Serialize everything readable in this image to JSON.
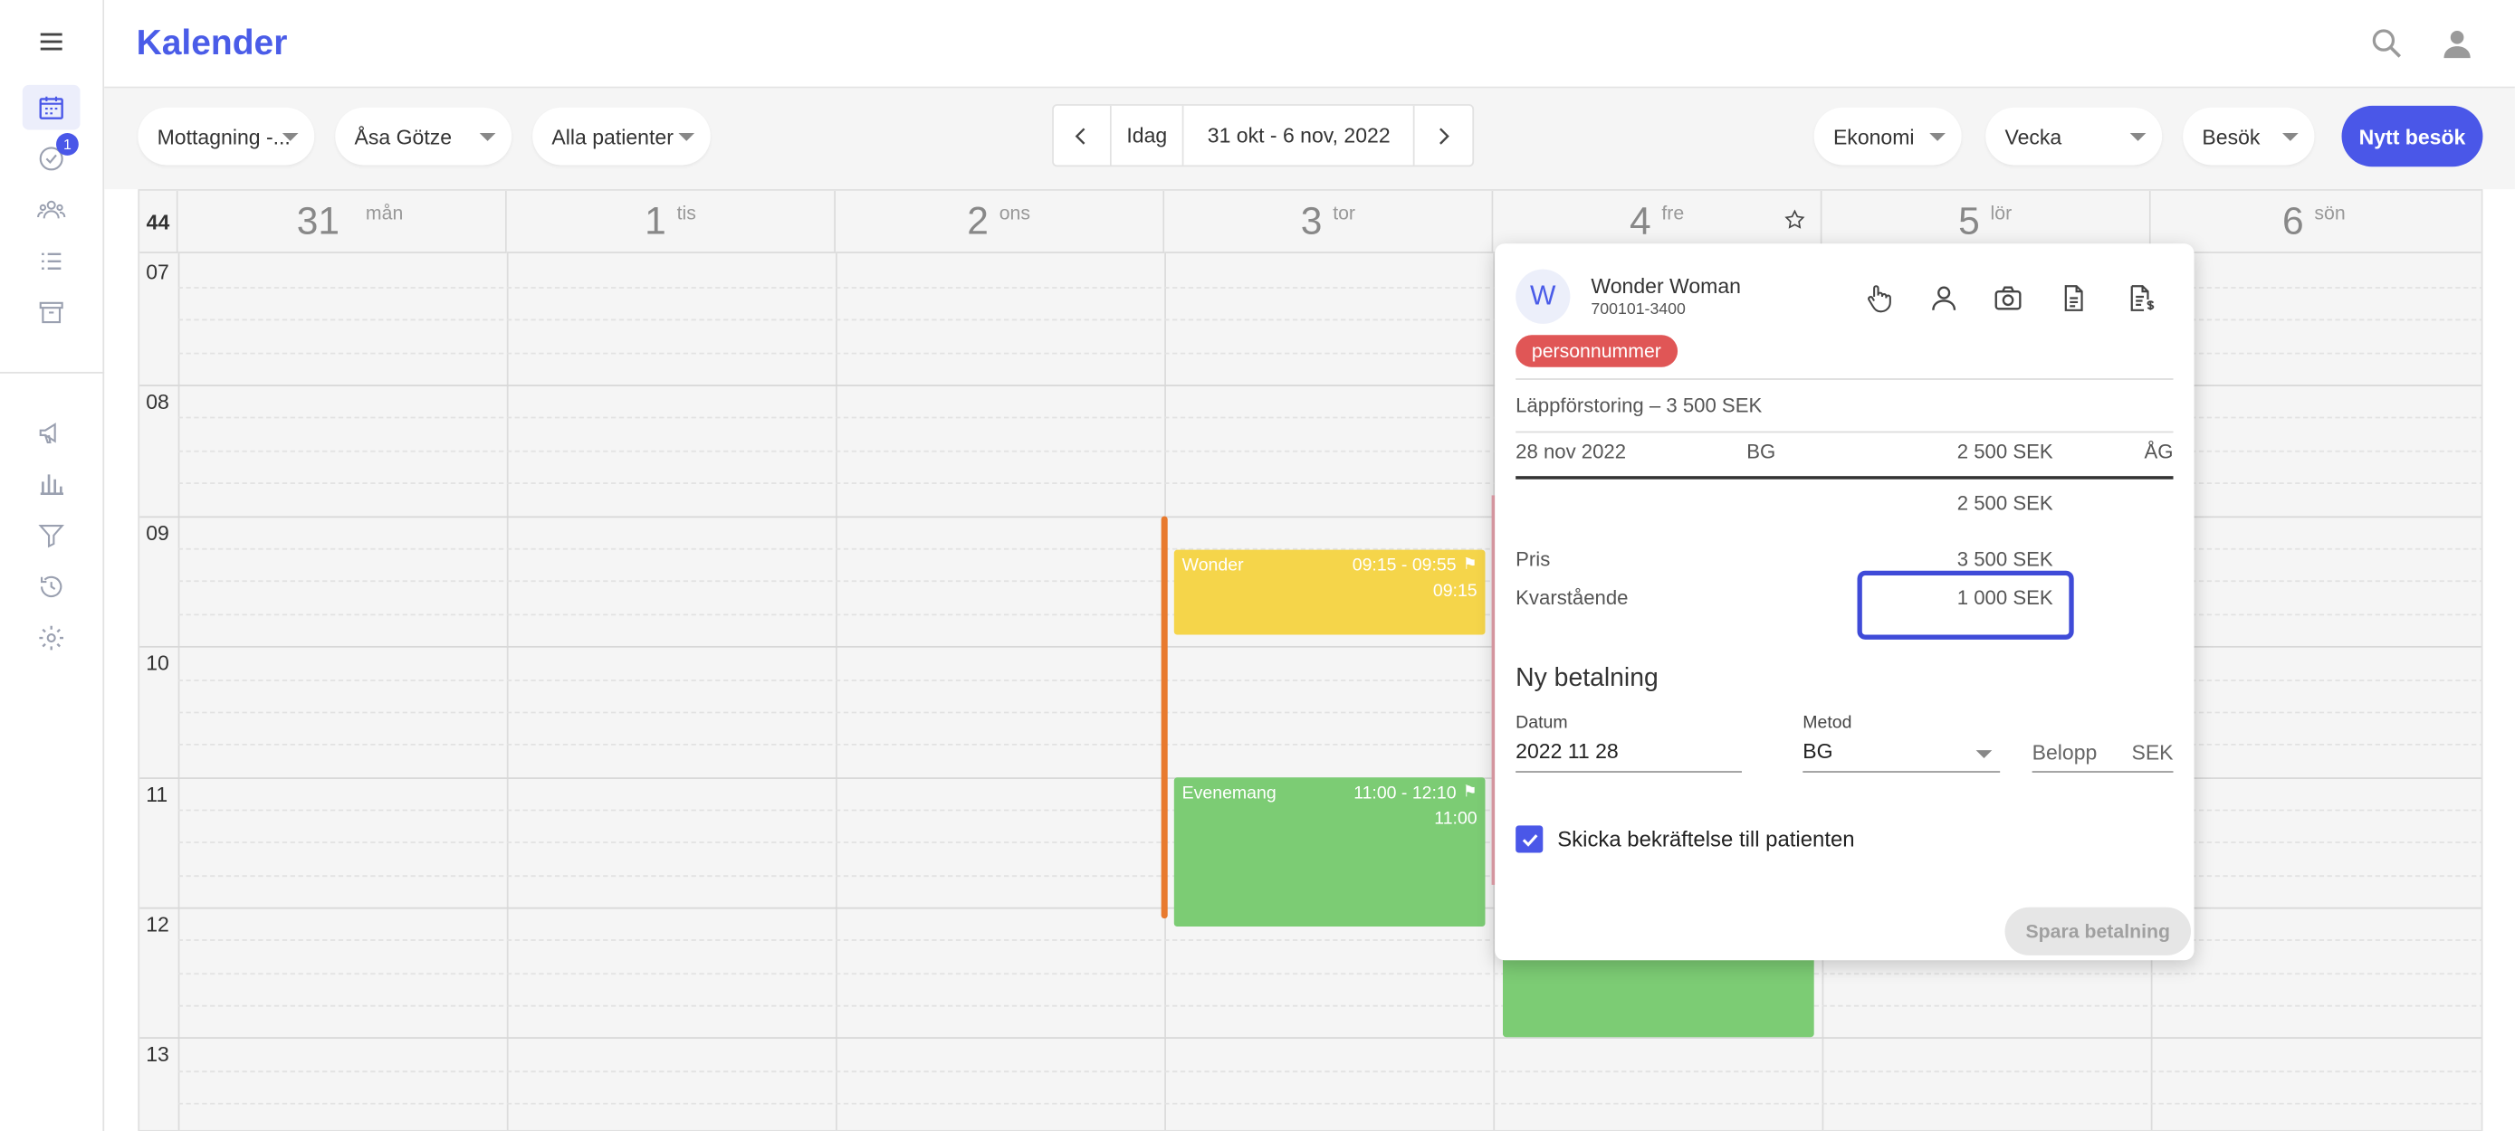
{
  "header": {
    "title": "Kalender"
  },
  "sidebar": {
    "badge_count": "1",
    "icons": [
      "calendar-icon",
      "tasks-icon",
      "people-icon",
      "list-icon",
      "archive-icon",
      "megaphone-icon",
      "bar-chart-icon",
      "filter-icon",
      "history-icon",
      "settings-icon"
    ]
  },
  "toolbar": {
    "reception": "Mottagning -...",
    "practitioner": "Åsa Götze",
    "patients": "Alla patienter",
    "today": "Idag",
    "date_range": "31 okt - 6 nov, 2022",
    "economy": "Ekonomi",
    "view": "Vecka",
    "visit_type": "Besök",
    "new_visit": "Nytt besök"
  },
  "calendar": {
    "week": "44",
    "days": [
      {
        "num": "31",
        "name": "mån"
      },
      {
        "num": "1",
        "name": "tis"
      },
      {
        "num": "2",
        "name": "ons"
      },
      {
        "num": "3",
        "name": "tor"
      },
      {
        "num": "4",
        "name": "fre"
      },
      {
        "num": "5",
        "name": "lör"
      },
      {
        "num": "6",
        "name": "sön"
      }
    ],
    "hours": [
      "07",
      "08",
      "09",
      "10",
      "11",
      "12",
      "13"
    ],
    "events": [
      {
        "name": "Wonder",
        "time": "09:15 - 09:55",
        "start": "09:15",
        "color": "#f5d54a"
      },
      {
        "name": "Evenemang",
        "time": "11:00 - 12:10",
        "start": "11:00",
        "color": "#7ccc74"
      }
    ]
  },
  "popup": {
    "avatar_letter": "W",
    "patient_name": "Wonder Woman",
    "patient_id": "700101-3400",
    "tag": "personnummer",
    "treatment": "Läppförstoring – 3 500 SEK",
    "payment_row": {
      "date": "28 nov 2022",
      "method": "BG",
      "amount": "2 500 SEK",
      "signature": "ÅG"
    },
    "subtotal": "2 500 SEK",
    "price_label": "Pris",
    "price_value": "3 500 SEK",
    "remaining_label": "Kvarstående",
    "remaining_value": "1 000 SEK",
    "new_payment_title": "Ny betalning",
    "date_label": "Datum",
    "date_value": "2022 11 28",
    "method_label": "Metod",
    "method_value": "BG",
    "amount_placeholder": "Belopp",
    "currency": "SEK",
    "confirm_label": "Skicka bekräftelse till patienten",
    "save_button": "Spara betalning"
  },
  "colors": {
    "accent": "#4a57e8",
    "tag": "#e05656",
    "event_yellow": "#f5d54a",
    "event_green": "#7ccc74",
    "bar_orange": "#e87a2e"
  }
}
